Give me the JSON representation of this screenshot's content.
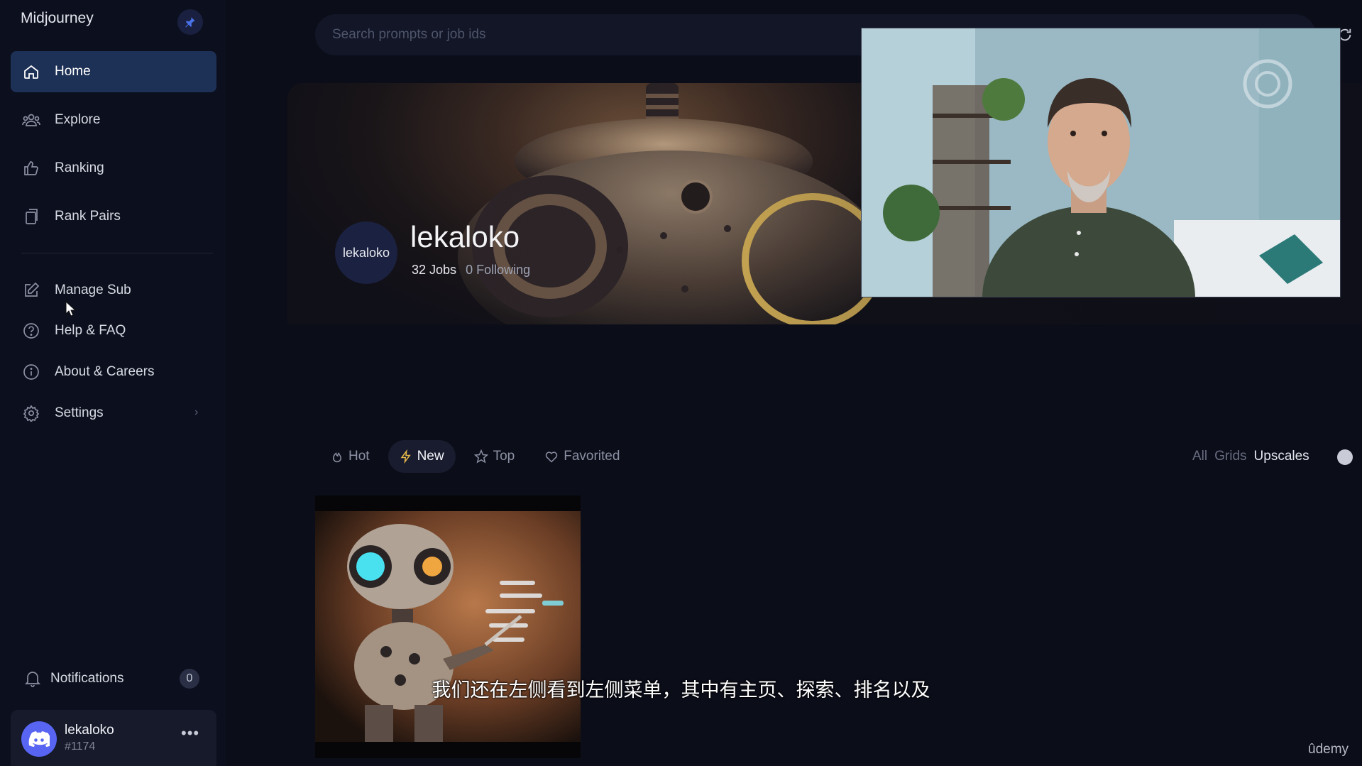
{
  "sidebar": {
    "brand": "Midjourney",
    "items": [
      {
        "label": "Home"
      },
      {
        "label": "Explore"
      },
      {
        "label": "Ranking"
      },
      {
        "label": "Rank Pairs"
      },
      {
        "label": "Manage Sub"
      },
      {
        "label": "Help & FAQ"
      },
      {
        "label": "About & Careers"
      },
      {
        "label": "Settings"
      }
    ],
    "notifications": {
      "label": "Notifications",
      "count": "0"
    },
    "user": {
      "name": "lekaloko",
      "tag": "#1174",
      "more": "•••"
    }
  },
  "search": {
    "placeholder": "Search prompts or job ids"
  },
  "profile": {
    "avatar_text": "lekaloko",
    "name": "lekaloko",
    "jobs": "32 Jobs",
    "following": "0 Following"
  },
  "tabs": [
    {
      "label": "Hot"
    },
    {
      "label": "New"
    },
    {
      "label": "Top"
    },
    {
      "label": "Favorited"
    }
  ],
  "filters": {
    "all": "All",
    "grids": "Grids",
    "upscales": "Upscales"
  },
  "subtitle": "我们还在左侧看到左侧菜单，其中有主页、探索、排名以及",
  "watermark": "ûdemy",
  "colors": {
    "active_nav": "#1d3055",
    "background": "#0b0d19",
    "discord": "#5865f2"
  }
}
